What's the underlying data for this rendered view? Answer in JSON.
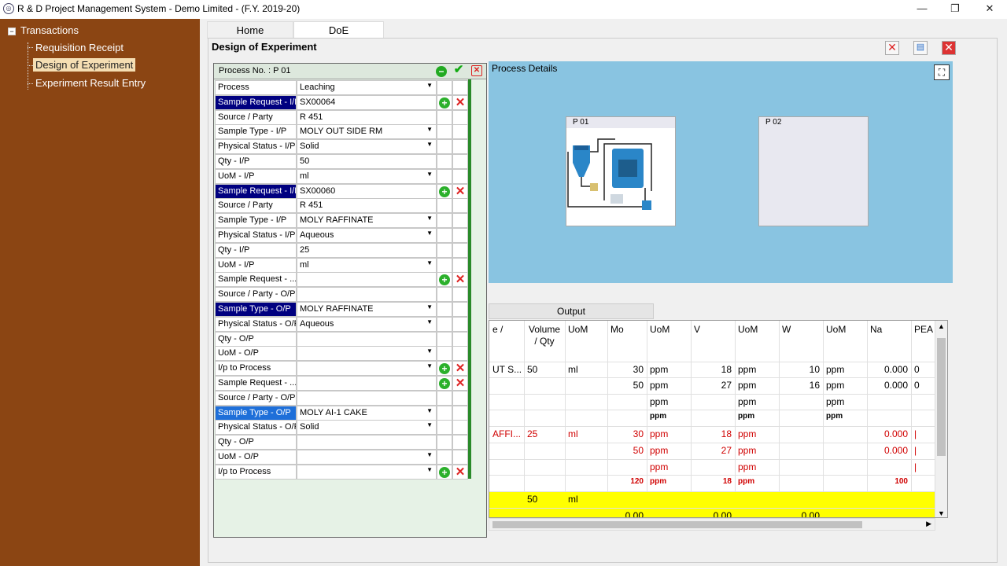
{
  "window": {
    "title": "R & D Project Management System - Demo Limited - (F.Y. 2019-20)",
    "minimize": "—",
    "restore": "❐",
    "close": "✕"
  },
  "sidebar": {
    "root": {
      "toggle": "−",
      "label": "Transactions"
    },
    "items": [
      {
        "label": "Requisition Receipt"
      },
      {
        "label": "Design of Experiment"
      },
      {
        "label": "Experiment Result Entry"
      }
    ]
  },
  "tabs": [
    {
      "label": "Home"
    },
    {
      "label": "DoE"
    }
  ],
  "panel": {
    "title": "Design of Experiment"
  },
  "grid": {
    "process_no": "Process No. : P 01",
    "rows": [
      {
        "label": "Process",
        "value": "Leaching",
        "dropdown": true
      },
      {
        "label": "Sample Request - I/P",
        "value": "SX00064",
        "add": true,
        "del": true,
        "hl": 1
      },
      {
        "label": "Source / Party",
        "value": "R 451"
      },
      {
        "label": "Sample Type - I/P",
        "value": "MOLY OUT SIDE RM",
        "dropdown": true
      },
      {
        "label": "Physical Status - I/P",
        "value": "Solid",
        "dropdown": true
      },
      {
        "label": "Qty - I/P",
        "value": "50"
      },
      {
        "label": "UoM - I/P",
        "value": "ml",
        "dropdown": true
      },
      {
        "label": "Sample Request - I/P",
        "value": "SX00060",
        "add": true,
        "del": true,
        "hl": 1
      },
      {
        "label": "Source / Party",
        "value": "R 451"
      },
      {
        "label": "Sample Type - I/P",
        "value": "MOLY RAFFINATE",
        "dropdown": true
      },
      {
        "label": "Physical Status - I/P",
        "value": "Aqueous",
        "dropdown": true
      },
      {
        "label": "Qty - I/P",
        "value": "25"
      },
      {
        "label": "UoM - I/P",
        "value": "ml",
        "dropdown": true
      },
      {
        "label": "Sample Request - ...",
        "value": "",
        "add": true,
        "del": true
      },
      {
        "label": "Source / Party - O/P",
        "value": ""
      },
      {
        "label": "Sample Type - O/P",
        "value": "MOLY RAFFINATE",
        "dropdown": true,
        "hl": 1
      },
      {
        "label": "Physical Status - O/P",
        "value": "Aqueous",
        "dropdown": true
      },
      {
        "label": "Qty - O/P",
        "value": ""
      },
      {
        "label": "UoM - O/P",
        "value": "",
        "dropdown": true
      },
      {
        "label": "I/p to Process",
        "value": "",
        "dropdown": true,
        "add": true,
        "del": true
      },
      {
        "label": "Sample Request - ...",
        "value": "",
        "add": true,
        "del": true
      },
      {
        "label": "Source / Party - O/P",
        "value": ""
      },
      {
        "label": "Sample Type - O/P",
        "value": "MOLY AI-1 CAKE",
        "dropdown": true,
        "hl": 2
      },
      {
        "label": "Physical Status - O/P",
        "value": "Solid",
        "dropdown": true
      },
      {
        "label": "Qty - O/P",
        "value": ""
      },
      {
        "label": "UoM - O/P",
        "value": "",
        "dropdown": true
      },
      {
        "label": "I/p to Process",
        "value": "",
        "dropdown": true,
        "add": true,
        "del": true
      }
    ]
  },
  "process_details": {
    "label": "Process Details",
    "cards": [
      {
        "label": "P 01"
      },
      {
        "label": "P 02"
      }
    ]
  },
  "output": {
    "tab": "Output",
    "headers": [
      "e /",
      "Volume / Qty",
      "UoM",
      "Mo",
      "UoM",
      "V",
      "UoM",
      "W",
      "UoM",
      "Na",
      "PEA"
    ],
    "rows": [
      {
        "style": "n",
        "cells": [
          "UT S...",
          "50",
          "ml",
          "30",
          "ppm",
          "18",
          "ppm",
          "10",
          "ppm",
          "0.000",
          "0"
        ]
      },
      {
        "style": "n",
        "cells": [
          "",
          "",
          "",
          "50",
          "ppm",
          "27",
          "ppm",
          "16",
          "ppm",
          "0.000",
          "0"
        ]
      },
      {
        "style": "n",
        "cells": [
          "",
          "",
          "",
          "",
          "ppm",
          "",
          "ppm",
          "",
          "ppm",
          "",
          ""
        ]
      },
      {
        "style": "b",
        "cells": [
          "",
          "",
          "",
          "",
          "ppm",
          "",
          "ppm",
          "",
          "ppm",
          "",
          ""
        ]
      },
      {
        "style": "r",
        "cells": [
          "AFFI...",
          "25",
          "ml",
          "30",
          "ppm",
          "18",
          "ppm",
          "",
          "",
          "0.000",
          "|"
        ]
      },
      {
        "style": "r",
        "cells": [
          "",
          "",
          "",
          "50",
          "ppm",
          "27",
          "ppm",
          "",
          "",
          "0.000",
          "|"
        ]
      },
      {
        "style": "r",
        "cells": [
          "",
          "",
          "",
          "",
          "ppm",
          "",
          "ppm",
          "",
          "",
          "",
          "|"
        ]
      },
      {
        "style": "rb",
        "cells": [
          "",
          "",
          "",
          "120",
          "ppm",
          "18",
          "ppm",
          "",
          "",
          "100",
          ""
        ]
      },
      {
        "style": "y",
        "cells": [
          "",
          "50",
          "ml",
          "",
          "",
          "",
          "",
          "",
          "",
          "",
          ""
        ]
      },
      {
        "style": "y",
        "cells": [
          "",
          "",
          "",
          "0.00",
          "",
          "0.00",
          "",
          "0.00",
          "",
          "",
          ""
        ]
      }
    ]
  },
  "colors": {
    "sidebar": "#8b4513",
    "selected_item": "#f5deb3",
    "hl_navy": "#000080",
    "hl_blue": "#1e6fd9",
    "yellow_row": "#ffff00",
    "process_bg": "#89c4e1"
  }
}
